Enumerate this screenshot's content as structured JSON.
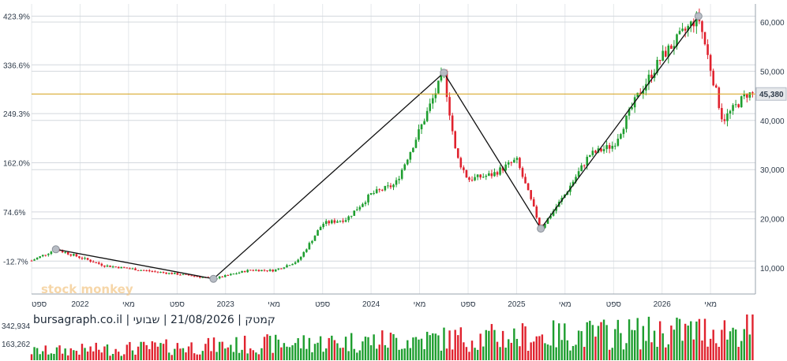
{
  "chart_data": {
    "type": "candlestick",
    "footer": "bursagraph.co.il | קמטק | 21/08/2026 | שבועי",
    "watermark": "stock monkey",
    "current_price_label": "45,380",
    "current_price": 45380,
    "left_axis_ticks": [
      "423.9%",
      "336.6%",
      "249.3%",
      "162.0%",
      "74.6%",
      "-12.7%"
    ],
    "right_axis_ticks": [
      {
        "label": "60,000",
        "value": 60000
      },
      {
        "label": "50,000",
        "value": 50000
      },
      {
        "label": "40,000",
        "value": 40000
      },
      {
        "label": "30,000",
        "value": 30000
      },
      {
        "label": "20,000",
        "value": 20000
      },
      {
        "label": "10,000",
        "value": 10000
      }
    ],
    "volume_ticks": [
      "342,934",
      "163,262"
    ],
    "x_ticks": [
      "ספט",
      "2022",
      "מאי",
      "ספט",
      "2023",
      "מאי",
      "ספט",
      "2024",
      "מאי",
      "ספט",
      "2025",
      "מאי",
      "ספט",
      "2026",
      "מאי"
    ],
    "trendline_points": [
      {
        "date": "2021-11",
        "price": 13800
      },
      {
        "date": "2022-12",
        "price": 7800
      },
      {
        "date": "2024-07",
        "price": 49700
      },
      {
        "date": "2025-03",
        "price": 18000
      },
      {
        "date": "2026-04",
        "price": 61200
      }
    ],
    "price_anchors": [
      {
        "date": "2021-09",
        "price": 11500
      },
      {
        "date": "2021-11",
        "price": 13800
      },
      {
        "date": "2022-03",
        "price": 10500
      },
      {
        "date": "2022-07",
        "price": 9300
      },
      {
        "date": "2022-10",
        "price": 8500
      },
      {
        "date": "2022-12",
        "price": 7800
      },
      {
        "date": "2023-03",
        "price": 9600
      },
      {
        "date": "2023-05",
        "price": 9500
      },
      {
        "date": "2023-07",
        "price": 11500
      },
      {
        "date": "2023-09",
        "price": 19000
      },
      {
        "date": "2023-11",
        "price": 20000
      },
      {
        "date": "2024-01",
        "price": 25000
      },
      {
        "date": "2024-03",
        "price": 27000
      },
      {
        "date": "2024-05",
        "price": 38000
      },
      {
        "date": "2024-07",
        "price": 49700
      },
      {
        "date": "2024-08",
        "price": 33000
      },
      {
        "date": "2024-09",
        "price": 28000
      },
      {
        "date": "2024-11",
        "price": 29000
      },
      {
        "date": "2025-01",
        "price": 32000
      },
      {
        "date": "2025-03",
        "price": 18000
      },
      {
        "date": "2025-05",
        "price": 25000
      },
      {
        "date": "2025-07",
        "price": 33000
      },
      {
        "date": "2025-09",
        "price": 35000
      },
      {
        "date": "2025-11",
        "price": 45000
      },
      {
        "date": "2026-01",
        "price": 53000
      },
      {
        "date": "2026-04",
        "price": 61200
      },
      {
        "date": "2026-06",
        "price": 40000
      },
      {
        "date": "2026-08",
        "price": 45380
      }
    ]
  }
}
